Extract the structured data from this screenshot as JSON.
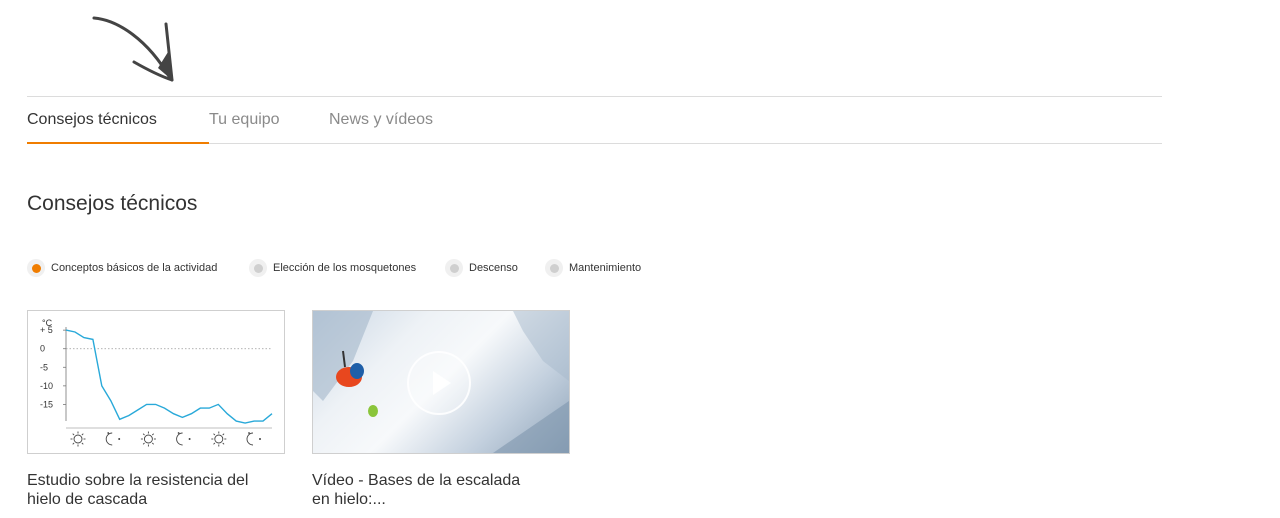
{
  "tabs": [
    {
      "label": "Consejos técnicos",
      "active": true
    },
    {
      "label": "Tu equipo",
      "active": false
    },
    {
      "label": "News y vídeos",
      "active": false
    }
  ],
  "section_title": "Consejos técnicos",
  "filters": [
    {
      "label": "Conceptos básicos de la actividad",
      "active": true
    },
    {
      "label": "Elección de los mosquetones",
      "active": false
    },
    {
      "label": "Descenso",
      "active": false
    },
    {
      "label": "Mantenimiento",
      "active": false
    }
  ],
  "cards": [
    {
      "title": "Estudio sobre la resistencia del hielo de cascada",
      "thumb": "temperature-chart"
    },
    {
      "title": "Vídeo - Bases de la escalada en hielo:...",
      "thumb": "ice-climbing-video"
    }
  ],
  "colors": {
    "accent": "#f07d00",
    "chart_line": "#29a9d9"
  },
  "chart_data": {
    "type": "line",
    "ylabel": "°C",
    "yticks": [
      "+ 5",
      "0",
      "-5",
      "-10",
      "-15"
    ],
    "ytick_values": [
      5,
      0,
      -5,
      -10,
      -15
    ],
    "ylim": [
      -20,
      8
    ],
    "x_icons": [
      "sun",
      "moon",
      "sun",
      "moon",
      "sun",
      "moon"
    ],
    "series": [
      {
        "values": [
          5,
          4.5,
          3,
          2.5,
          -10,
          -14,
          -19,
          -18,
          -16.5,
          -15,
          -15,
          -16,
          -17.5,
          -18.5,
          -17.5,
          -16,
          -16,
          -15,
          -17.5,
          -19.5,
          -20,
          -19.5,
          -19.5,
          -17.5
        ]
      }
    ]
  }
}
